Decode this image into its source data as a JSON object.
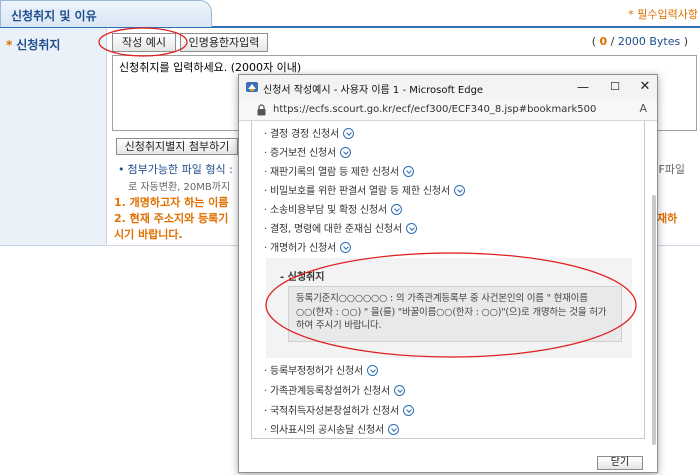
{
  "section": {
    "title": "신청취지 및 이유",
    "required_note": "* 필수입력사항"
  },
  "row": {
    "label": "신청취지",
    "bullet": "*"
  },
  "buttons": {
    "example": "작성 예시",
    "hanja": "인명용한자입력",
    "attach": "신청취지별지 첨부하기"
  },
  "byte_counter": {
    "open": "(",
    "current": "0",
    "separator": " / ",
    "max": "2000 Bytes",
    "close": ")"
  },
  "purpose_input": {
    "value": "신청취지를 입력하세요. (2000자 이내)"
  },
  "notes": {
    "bullet": "•",
    "file_format": "첨부가능한 파일 형식 :",
    "file_format_right": "DF파일",
    "file_convert": "로 자동변환, 20MB까지",
    "warn1": "1. 개명하고자 하는 이름",
    "warn2": "2. 현재 주소지와 등록기",
    "warn2_right": "재하",
    "warn3": "시기 바랍니다."
  },
  "popup": {
    "window_title": "신청서 작성예시 - 사용자 이름 1 - Microsoft Edge",
    "url": "https://ecfs.scourt.go.kr/ecf/ecf300/ECF340_8.jsp#bookmark500",
    "controls": {
      "minimize": "—",
      "maximize": "☐",
      "close": "✕"
    },
    "reader_label": "A",
    "list_bullet": "·",
    "items_top": [
      "결정 경정 신청서",
      "증거보전 신청서",
      "재판기록의 열람 등 제한 신청서",
      "비밀보호를 위한 판결서 열람 등 제한 신청서",
      "소송비용부담 및 확정 신청서",
      "결정, 명령에 대한 준재심 신청서",
      "개명허가 신청서"
    ],
    "expanded": {
      "title": "- 신청취지",
      "text": "등록기준지○○○○○○ : 의 가족관계등록부 중 사건본인의 이름 \" 현재이름 ○○(한자 : ○○) \" 을(를) \"바꿀이름○○(한자 : ○○)\"(으)로 개명하는 것을 허가하여 주시기 바랍니다."
    },
    "items_bottom": [
      "등록부정정허가 신청서",
      "가족관계등록창설허가 신청서",
      "국적취득자성본창설허가 신청서",
      "의사표시의 공시송달 신청서"
    ],
    "close_button": "닫기"
  },
  "colors": {
    "accent_blue": "#2f6fb3",
    "warning_orange": "#e07000",
    "annotation_red": "#e02020"
  }
}
